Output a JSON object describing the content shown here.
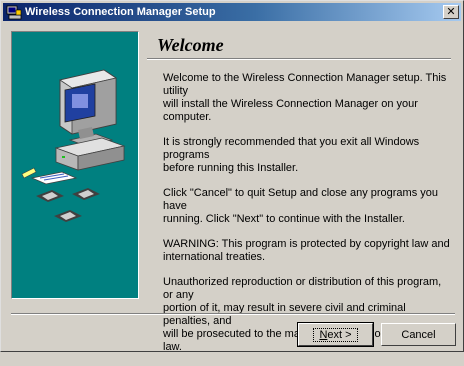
{
  "window": {
    "title": "Wireless Connection Manager Setup",
    "app_icon": "setup-icon",
    "close_glyph": "✕"
  },
  "content": {
    "heading": "Welcome",
    "paragraphs": [
      "Welcome to the Wireless Connection Manager setup.  This utility\nwill install the Wireless Connection Manager on your computer.",
      "It is strongly recommended that you exit all Windows programs\nbefore running this Installer.",
      "Click \"Cancel\" to quit Setup and close any programs you have\nrunning.  Click \"Next\" to continue with the Installer.",
      "WARNING: This program is protected by copyright law and\ninternational treaties.",
      "Unauthorized reproduction or distribution of this program, or any\nportion of it, may result in severe civil and criminal penalties, and\nwill be prosecuted to the maximum extent possible under law."
    ]
  },
  "buttons": {
    "next_underlined": "N",
    "next_rest": "ext >",
    "cancel": "Cancel"
  },
  "colors": {
    "titlebar_start": "#0a246a",
    "titlebar_end": "#a6caf0",
    "side_panel": "#008080",
    "dialog_face": "#d4d0c8"
  }
}
